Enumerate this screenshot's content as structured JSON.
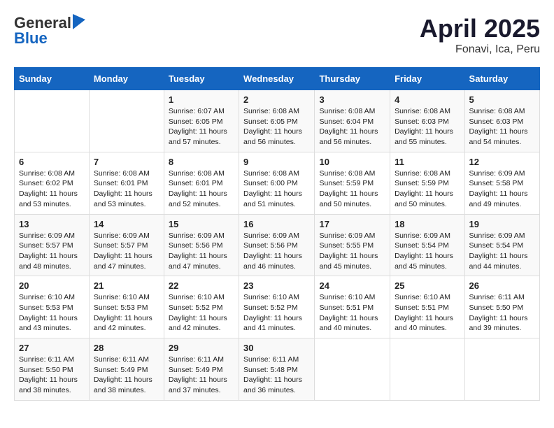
{
  "logo": {
    "general": "General",
    "blue": "Blue"
  },
  "title": "April 2025",
  "subtitle": "Fonavi, Ica, Peru",
  "days_header": [
    "Sunday",
    "Monday",
    "Tuesday",
    "Wednesday",
    "Thursday",
    "Friday",
    "Saturday"
  ],
  "weeks": [
    [
      {
        "num": "",
        "info": ""
      },
      {
        "num": "",
        "info": ""
      },
      {
        "num": "1",
        "info": "Sunrise: 6:07 AM\nSunset: 6:05 PM\nDaylight: 11 hours and 57 minutes."
      },
      {
        "num": "2",
        "info": "Sunrise: 6:08 AM\nSunset: 6:05 PM\nDaylight: 11 hours and 56 minutes."
      },
      {
        "num": "3",
        "info": "Sunrise: 6:08 AM\nSunset: 6:04 PM\nDaylight: 11 hours and 56 minutes."
      },
      {
        "num": "4",
        "info": "Sunrise: 6:08 AM\nSunset: 6:03 PM\nDaylight: 11 hours and 55 minutes."
      },
      {
        "num": "5",
        "info": "Sunrise: 6:08 AM\nSunset: 6:03 PM\nDaylight: 11 hours and 54 minutes."
      }
    ],
    [
      {
        "num": "6",
        "info": "Sunrise: 6:08 AM\nSunset: 6:02 PM\nDaylight: 11 hours and 53 minutes."
      },
      {
        "num": "7",
        "info": "Sunrise: 6:08 AM\nSunset: 6:01 PM\nDaylight: 11 hours and 53 minutes."
      },
      {
        "num": "8",
        "info": "Sunrise: 6:08 AM\nSunset: 6:01 PM\nDaylight: 11 hours and 52 minutes."
      },
      {
        "num": "9",
        "info": "Sunrise: 6:08 AM\nSunset: 6:00 PM\nDaylight: 11 hours and 51 minutes."
      },
      {
        "num": "10",
        "info": "Sunrise: 6:08 AM\nSunset: 5:59 PM\nDaylight: 11 hours and 50 minutes."
      },
      {
        "num": "11",
        "info": "Sunrise: 6:08 AM\nSunset: 5:59 PM\nDaylight: 11 hours and 50 minutes."
      },
      {
        "num": "12",
        "info": "Sunrise: 6:09 AM\nSunset: 5:58 PM\nDaylight: 11 hours and 49 minutes."
      }
    ],
    [
      {
        "num": "13",
        "info": "Sunrise: 6:09 AM\nSunset: 5:57 PM\nDaylight: 11 hours and 48 minutes."
      },
      {
        "num": "14",
        "info": "Sunrise: 6:09 AM\nSunset: 5:57 PM\nDaylight: 11 hours and 47 minutes."
      },
      {
        "num": "15",
        "info": "Sunrise: 6:09 AM\nSunset: 5:56 PM\nDaylight: 11 hours and 47 minutes."
      },
      {
        "num": "16",
        "info": "Sunrise: 6:09 AM\nSunset: 5:56 PM\nDaylight: 11 hours and 46 minutes."
      },
      {
        "num": "17",
        "info": "Sunrise: 6:09 AM\nSunset: 5:55 PM\nDaylight: 11 hours and 45 minutes."
      },
      {
        "num": "18",
        "info": "Sunrise: 6:09 AM\nSunset: 5:54 PM\nDaylight: 11 hours and 45 minutes."
      },
      {
        "num": "19",
        "info": "Sunrise: 6:09 AM\nSunset: 5:54 PM\nDaylight: 11 hours and 44 minutes."
      }
    ],
    [
      {
        "num": "20",
        "info": "Sunrise: 6:10 AM\nSunset: 5:53 PM\nDaylight: 11 hours and 43 minutes."
      },
      {
        "num": "21",
        "info": "Sunrise: 6:10 AM\nSunset: 5:53 PM\nDaylight: 11 hours and 42 minutes."
      },
      {
        "num": "22",
        "info": "Sunrise: 6:10 AM\nSunset: 5:52 PM\nDaylight: 11 hours and 42 minutes."
      },
      {
        "num": "23",
        "info": "Sunrise: 6:10 AM\nSunset: 5:52 PM\nDaylight: 11 hours and 41 minutes."
      },
      {
        "num": "24",
        "info": "Sunrise: 6:10 AM\nSunset: 5:51 PM\nDaylight: 11 hours and 40 minutes."
      },
      {
        "num": "25",
        "info": "Sunrise: 6:10 AM\nSunset: 5:51 PM\nDaylight: 11 hours and 40 minutes."
      },
      {
        "num": "26",
        "info": "Sunrise: 6:11 AM\nSunset: 5:50 PM\nDaylight: 11 hours and 39 minutes."
      }
    ],
    [
      {
        "num": "27",
        "info": "Sunrise: 6:11 AM\nSunset: 5:50 PM\nDaylight: 11 hours and 38 minutes."
      },
      {
        "num": "28",
        "info": "Sunrise: 6:11 AM\nSunset: 5:49 PM\nDaylight: 11 hours and 38 minutes."
      },
      {
        "num": "29",
        "info": "Sunrise: 6:11 AM\nSunset: 5:49 PM\nDaylight: 11 hours and 37 minutes."
      },
      {
        "num": "30",
        "info": "Sunrise: 6:11 AM\nSunset: 5:48 PM\nDaylight: 11 hours and 36 minutes."
      },
      {
        "num": "",
        "info": ""
      },
      {
        "num": "",
        "info": ""
      },
      {
        "num": "",
        "info": ""
      }
    ]
  ]
}
